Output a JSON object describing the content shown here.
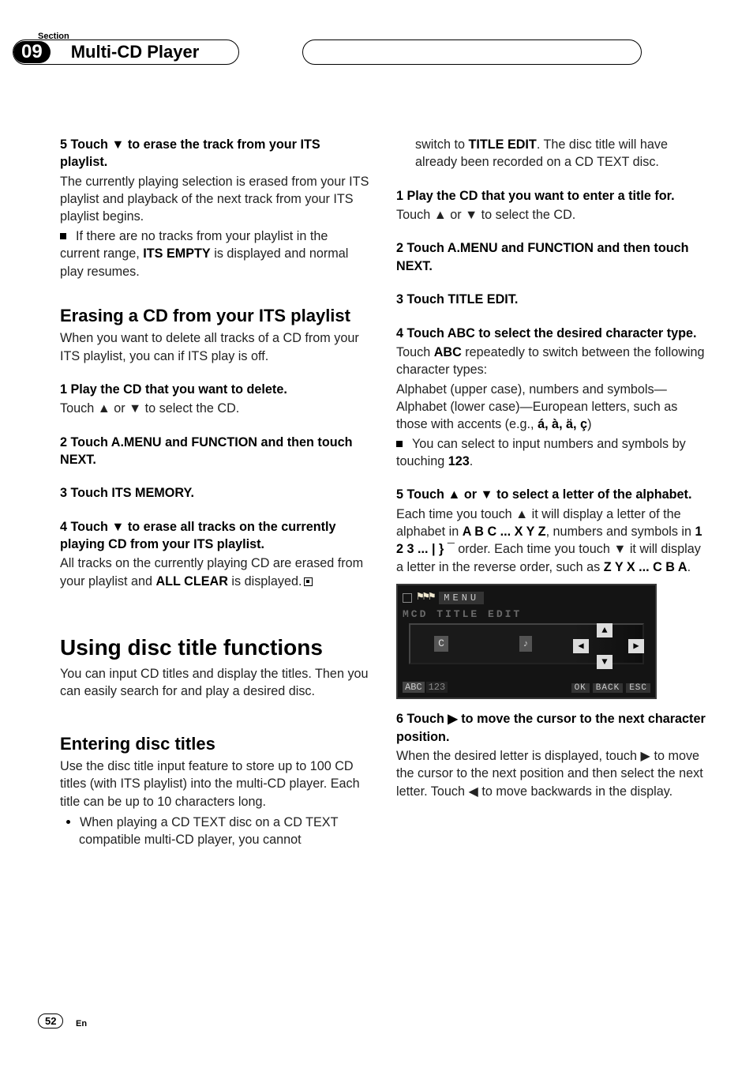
{
  "header": {
    "section_label": "Section",
    "section_number": "09",
    "title": "Multi-CD Player"
  },
  "left_column": {
    "step5": {
      "head": "5    Touch ▼ to erase the track from your ITS playlist.",
      "body1": "The currently playing selection is erased from your ITS playlist and playback of the next track from your ITS playlist begins.",
      "note_lead": "If there are no tracks from your playlist in the current range, ",
      "note_bold": "ITS EMPTY",
      "note_tail": " is displayed and normal play resumes."
    },
    "erase_heading": "Erasing a CD from your ITS playlist",
    "erase_intro": "When you want to delete all tracks of a CD from your ITS playlist, you can if ITS play is off.",
    "e_step1": {
      "head": "1    Play the CD that you want to delete.",
      "body": "Touch ▲ or ▼ to select the CD."
    },
    "e_step2": {
      "head": "2    Touch A.MENU and FUNCTION and then touch NEXT."
    },
    "e_step3": {
      "head": "3    Touch ITS MEMORY."
    },
    "e_step4": {
      "head": "4    Touch ▼ to erase all tracks on the currently playing CD from your ITS playlist.",
      "body_lead": "All tracks on the currently playing CD are erased from your playlist and ",
      "body_bold": "ALL CLEAR",
      "body_tail": " is displayed."
    },
    "using_heading": "Using disc title functions",
    "using_intro": "You can input CD titles and display the titles. Then you can easily search for and play a desired disc.",
    "enter_heading": "Entering disc titles",
    "enter_body": "Use the disc title input feature to store up to 100 CD titles  (with ITS playlist) into the multi-CD player. Each title can be up to 10 characters long.",
    "enter_bullet": "When playing a CD TEXT disc on a CD TEXT compatible multi-CD player, you cannot"
  },
  "right_column": {
    "cont_lead": "switch to ",
    "cont_bold": "TITLE EDIT",
    "cont_tail": ". The disc title will have already been recorded on a CD TEXT disc.",
    "r_step1": {
      "head": "1    Play the CD that you want to enter a title for.",
      "body": "Touch ▲ or ▼ to select the CD."
    },
    "r_step2": {
      "head": "2    Touch A.MENU and FUNCTION and then touch NEXT."
    },
    "r_step3": {
      "head": "3    Touch TITLE EDIT."
    },
    "r_step4": {
      "head": "4    Touch ABC to select the desired character type.",
      "body_lead": "Touch ",
      "body_bold": "ABC",
      "body_tail": " repeatedly to switch between the following character types:",
      "types_lead": "Alphabet (upper case), numbers and symbols—Alphabet (lower case)—European letters, such as those with accents (e.g., ",
      "types_bold": "á, à, ä, ç",
      "types_tail": ")",
      "note_lead": "You can select to input numbers and symbols by touching ",
      "note_bold": "123",
      "note_tail": "."
    },
    "r_step5": {
      "head": "5    Touch ▲ or ▼ to select a letter of the alphabet.",
      "body_lead": "Each time you touch ▲ it will display a letter of the alphabet in ",
      "seq1": "A B C ... X Y Z",
      "body_mid": ", numbers and symbols in ",
      "seq2": "1 2 3 ... | } ¯",
      "body_mid2": " order. Each time you touch ▼ it will display a letter in the reverse order, such as ",
      "seq3": "Z Y X ... C B A",
      "body_tail": "."
    },
    "r_step6": {
      "head": "6    Touch ▶ to move the cursor to the next character position.",
      "body": "When the desired letter is displayed, touch ▶ to move the cursor to the next position and then select the next letter. Touch ◀ to move backwards in the display."
    }
  },
  "screenshot": {
    "menu_label": "MENU",
    "sub_label": "MCD  TITLE  EDIT",
    "letter": "C",
    "abc": "ABC",
    "n123": "123",
    "ok": "OK",
    "back": "BACK",
    "esc": "ESC"
  },
  "chart_data": {
    "type": "table",
    "title": "MCD TITLE EDIT screen",
    "notes": "On-screen title entry UI: current letter input box, directional arrow buttons (up/down/left/right), mode toggles ABC / 123, and action buttons OK / BACK / ESC."
  },
  "footer": {
    "page": "52",
    "lang": "En"
  }
}
